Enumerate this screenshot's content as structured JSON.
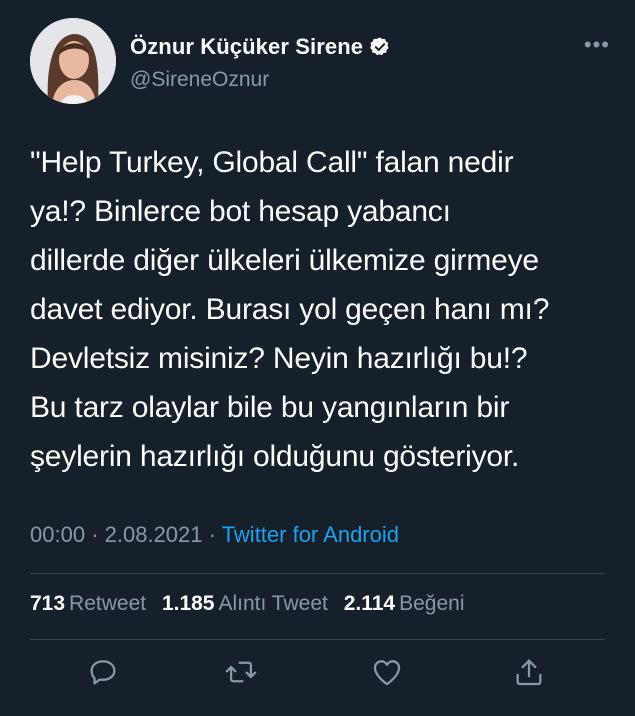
{
  "user": {
    "name": "Öznur Küçüker Sirene",
    "handle": "@SireneOznur"
  },
  "tweet": {
    "text": "\"Help Turkey, Global Call\" falan nedir\nya!? Binlerce bot hesap yabancı\ndillerde diğer ülkeleri ülkemize girmeye\ndavet ediyor. Burası yol geçen hanı mı?\nDevletsiz misiniz? Neyin hazırlığı bu!?\nBu tarz olaylar bile bu yangınların bir\nşeylerin hazırlığı olduğunu gösteriyor.",
    "time": "00:00",
    "sep1": "·",
    "date": "2.08.2021",
    "sep2": "·",
    "source": "Twitter for Android"
  },
  "stats": {
    "retweets_count": "713",
    "retweets_label": "Retweet",
    "quotes_count": "1.185",
    "quotes_label": "Alıntı Tweet",
    "likes_count": "2.114",
    "likes_label": "Beğeni"
  },
  "icons": {
    "reply": "reply-icon",
    "retweet": "retweet-icon",
    "like": "like-icon",
    "share": "share-icon",
    "more": "more-icon",
    "verified": "verified-badge-icon"
  },
  "colors": {
    "background": "#15202b",
    "text": "#ffffff",
    "secondary": "#8899a6",
    "link": "#1da1f2",
    "divider": "#38444d"
  }
}
